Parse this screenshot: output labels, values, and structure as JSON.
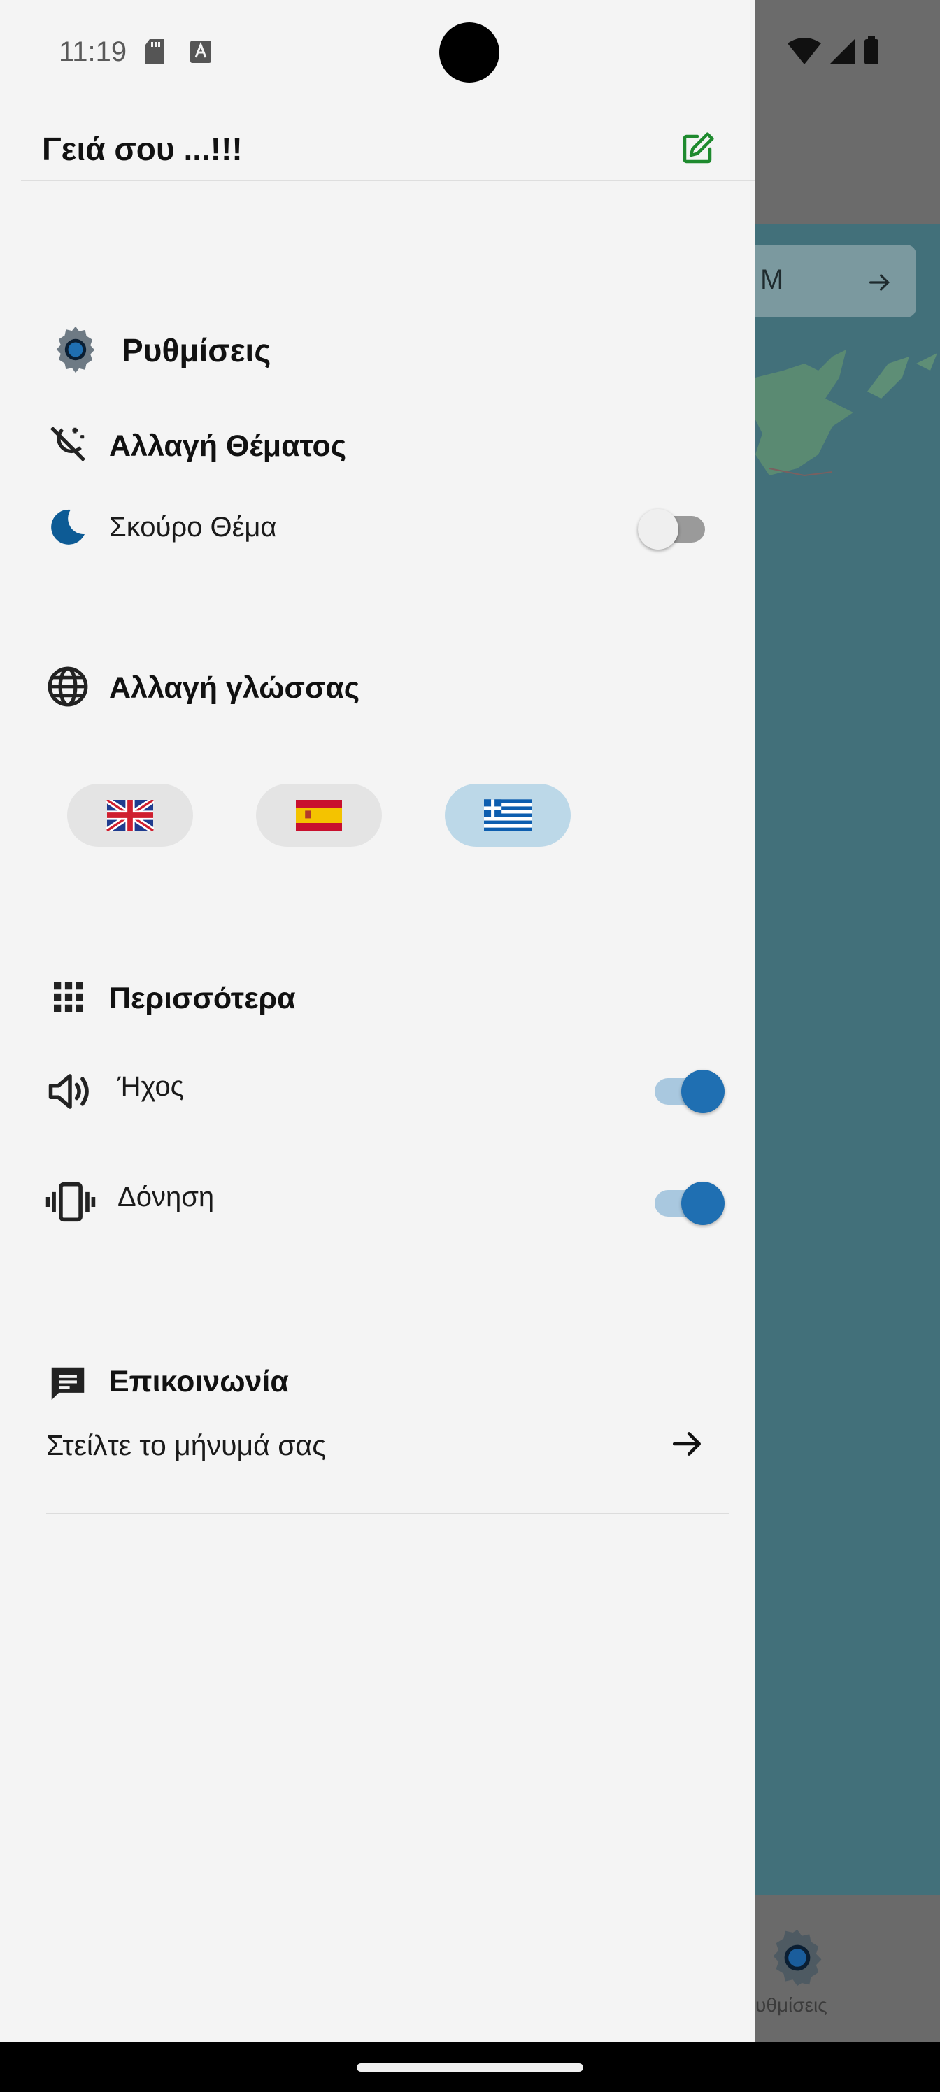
{
  "status_bar": {
    "time": "11:19",
    "icons": [
      "sd-card-icon",
      "keyboard-a-icon",
      "wifi-icon",
      "signal-icon",
      "battery-icon"
    ]
  },
  "drawer": {
    "greeting": "Γειά σου ...!!!",
    "edit_icon": "edit-icon",
    "settings": {
      "title": "Ρυθμίσεις",
      "icon": "gear-icon"
    },
    "theme": {
      "title": "Αλλαγή Θέματος",
      "icon": "theme-change-icon",
      "dark_mode_label": "Σκούρο Θέμα",
      "dark_mode_enabled": false,
      "moon_icon": "moon-icon"
    },
    "language": {
      "title": "Αλλαγή γλώσσας",
      "icon": "globe-icon",
      "options": [
        {
          "name": "english-flag-icon",
          "selected": false
        },
        {
          "name": "spanish-flag-icon",
          "selected": false
        },
        {
          "name": "greek-flag-icon",
          "selected": true
        }
      ]
    },
    "more": {
      "title": "Περισσότερα",
      "icon": "apps-grid-icon",
      "sound_label": "Ήχος",
      "sound_enabled": true,
      "vibration_label": "Δόνηση",
      "vibration_enabled": true
    },
    "contact": {
      "title": "Επικοινωνία",
      "icon": "chat-icon",
      "message_label": "Στείλτε το μήνυμά σας"
    }
  },
  "background": {
    "search_text": "M",
    "nav_label": "υθμίσεις"
  },
  "colors": {
    "accent": "#1f6fb2",
    "edit_icon": "#1e8a2e",
    "drawer_bg": "#f4f4f4",
    "scrim_map": "#42707a"
  }
}
